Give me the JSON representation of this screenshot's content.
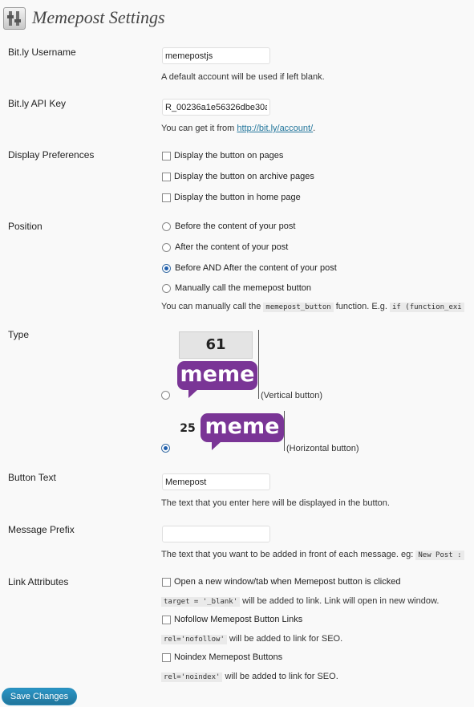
{
  "header": {
    "title": "Memepost Settings"
  },
  "bitly_username": {
    "label": "Bit.ly Username",
    "value": "memepostjs",
    "description": "A default account will be used if left blank."
  },
  "bitly_api_key": {
    "label": "Bit.ly API Key",
    "value": "R_00236a1e56326dbe30a",
    "description_prefix": "You can get it from ",
    "link_text": "http://bit.ly/account/",
    "description_suffix": "."
  },
  "display_preferences": {
    "label": "Display Preferences",
    "options": [
      {
        "label": "Display the button on pages",
        "checked": false
      },
      {
        "label": "Display the button on archive pages",
        "checked": false
      },
      {
        "label": "Display the button in home page",
        "checked": false
      }
    ]
  },
  "position": {
    "label": "Position",
    "options": [
      {
        "label": "Before the content of your post",
        "selected": false
      },
      {
        "label": "After the content of your post",
        "selected": false
      },
      {
        "label": "Before AND After the content of your post",
        "selected": true
      },
      {
        "label": "Manually call the memepost button",
        "selected": false
      }
    ],
    "note_prefix": "You can manually call the ",
    "note_code": "memepost_button",
    "note_middle": " function. E.g. ",
    "note_code2": "if (function_exi"
  },
  "type": {
    "label": "Type",
    "vertical": {
      "count": "61",
      "brand": "meme",
      "caption": "(Vertical button)",
      "selected": false
    },
    "horizontal": {
      "count": "25",
      "brand": "meme",
      "caption": "(Horizontal button)",
      "selected": true
    }
  },
  "button_text": {
    "label": "Button Text",
    "value": "Memepost",
    "description": "The text that you enter here will be displayed in the button."
  },
  "message_prefix": {
    "label": "Message Prefix",
    "value": "",
    "description": "The text that you want to be added in front of each message. eg: ",
    "example_code": "New Post :"
  },
  "link_attributes": {
    "label": "Link Attributes",
    "options": [
      {
        "label": "Open a new window/tab when Memepost button is clicked",
        "checked": false,
        "code": "target = '_blank'",
        "note": " will be added to link. Link will open in new window."
      },
      {
        "label": "Nofollow Memepost Button Links",
        "checked": false,
        "code": "rel='nofollow'",
        "note": " will be added to link for SEO."
      },
      {
        "label": "Noindex Memepost Buttons",
        "checked": false,
        "code": "rel='noindex'",
        "note": " will be added to link for SEO."
      }
    ]
  },
  "actions": {
    "save_label": "Save Changes"
  },
  "colors": {
    "link": "#21759b",
    "brand_purple": "#7a3596",
    "button_blue": "#21759b",
    "background": "#f9f9f9"
  }
}
